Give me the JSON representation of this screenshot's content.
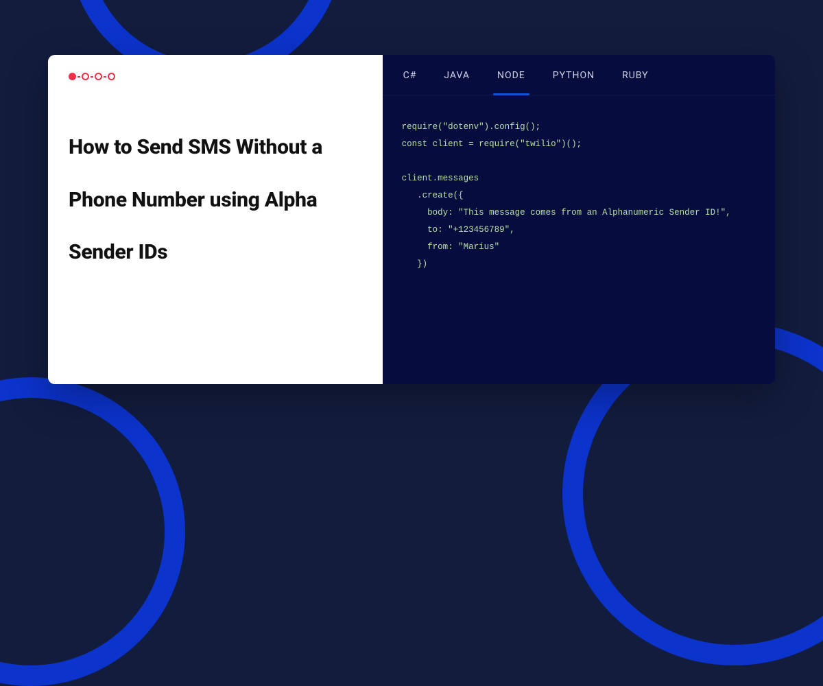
{
  "heading": "How to Send SMS Without a Phone Number using Alpha Sender IDs",
  "tabs": [
    {
      "label": "C#",
      "active": false
    },
    {
      "label": "JAVA",
      "active": false
    },
    {
      "label": "NODE",
      "active": true
    },
    {
      "label": "PYTHON",
      "active": false
    },
    {
      "label": "RUBY",
      "active": false
    }
  ],
  "code": "require(\"dotenv\").config();\nconst client = require(\"twilio\")();\n\nclient.messages\n   .create({\n     body: \"This message comes from an Alphanumeric Sender ID!\",\n     to: \"+123456789\",\n     from: \"Marius\"\n   })"
}
